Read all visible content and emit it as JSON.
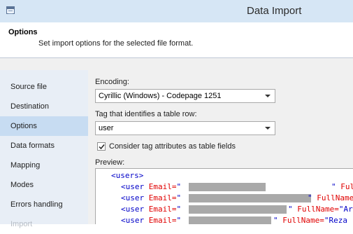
{
  "window": {
    "title": "Data Import",
    "icon": "table-icon"
  },
  "header": {
    "title": "Options",
    "description": "Set import options for the selected file format."
  },
  "sidebar": {
    "items": [
      {
        "label": "Source file",
        "selected": false
      },
      {
        "label": "Destination",
        "selected": false
      },
      {
        "label": "Options",
        "selected": true
      },
      {
        "label": "Data formats",
        "selected": false
      },
      {
        "label": "Mapping",
        "selected": false
      },
      {
        "label": "Modes",
        "selected": false
      },
      {
        "label": "Errors handling",
        "selected": false
      },
      {
        "label": "Import",
        "selected": false
      }
    ]
  },
  "options": {
    "encoding_label": "Encoding:",
    "encoding_value": "Cyrillic (Windows) - Codepage 1251",
    "tag_label": "Tag that identifies a table row:",
    "tag_value": "user",
    "checkbox_label": "Consider tag attributes as table fields",
    "checkbox_checked": true,
    "preview_label": "Preview:"
  },
  "preview": {
    "root_open": "<users>",
    "lines": [
      {
        "tag_open": "<user",
        "attr1": "Email=",
        "q1": "\"",
        "q1_close": "\"",
        "attr2": "Ful"
      },
      {
        "tag_open": "<user",
        "attr1": "Email=",
        "q1": "\"",
        "q1_close": "\"",
        "attr2": "FullName"
      },
      {
        "tag_open": "<user",
        "attr1": "Email=",
        "q1": "\"",
        "q1_close": "\"",
        "attr2": "FullName=",
        "val2": "\"Ar"
      },
      {
        "tag_open": "<user",
        "attr1": "Email=",
        "q1": "\"",
        "q1_close": "\"",
        "attr2": "FullName=",
        "val2": "\"Reza"
      }
    ]
  },
  "colors": {
    "titlebar": "#d6e6f5",
    "sidebar": "#e8eef6",
    "sidebar_selected": "#c7dcf2",
    "xml_tag": "#0000c8",
    "xml_attr": "#e00000"
  }
}
